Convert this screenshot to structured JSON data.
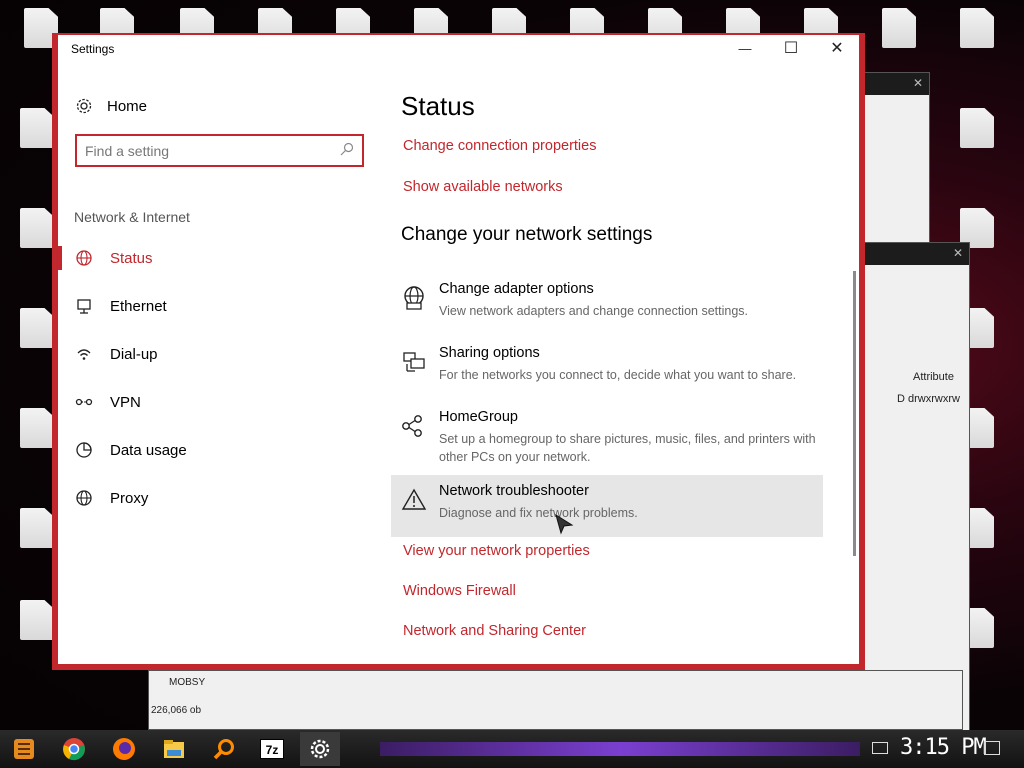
{
  "window": {
    "title": "Settings",
    "minimize_label": "—",
    "maximize_label": "☐",
    "close_label": "✕"
  },
  "sidebar": {
    "home_label": "Home",
    "search_placeholder": "Find a setting",
    "group_title": "Network & Internet",
    "items": [
      {
        "label": "Status",
        "icon": "status-globe-icon",
        "active": true
      },
      {
        "label": "Ethernet",
        "icon": "ethernet-icon"
      },
      {
        "label": "Dial-up",
        "icon": "dialup-icon"
      },
      {
        "label": "VPN",
        "icon": "vpn-icon"
      },
      {
        "label": "Data usage",
        "icon": "data-usage-icon"
      },
      {
        "label": "Proxy",
        "icon": "proxy-globe-icon"
      }
    ]
  },
  "main": {
    "title": "Status",
    "top_links": [
      "Change connection properties",
      "Show available networks"
    ],
    "section_title": "Change your network settings",
    "options": [
      {
        "title": "Change adapter options",
        "desc": "View network adapters and change connection settings.",
        "icon": "adapter-globe-icon"
      },
      {
        "title": "Sharing options",
        "desc": "For the networks you connect to, decide what you want to share.",
        "icon": "sharing-icon"
      },
      {
        "title": "HomeGroup",
        "desc": "Set up a homegroup to share pictures, music, files, and printers with other PCs on your network.",
        "icon": "homegroup-icon"
      },
      {
        "title": "Network troubleshooter",
        "desc": "Diagnose and fix network problems.",
        "icon": "warning-icon"
      }
    ],
    "bottom_links": [
      "View your network properties",
      "Windows Firewall",
      "Network and Sharing Center"
    ]
  },
  "background_window": {
    "column_header": "Attribute",
    "cell_value": "D drwxrwxrw",
    "status_text": "226,066 ob",
    "file_label": "MOBSY"
  },
  "taskbar": {
    "clock": "3:15 PM",
    "apps": [
      "start-icon",
      "chrome-icon",
      "firefox-icon",
      "file-explorer-icon",
      "search-icon",
      "7zip-icon",
      "settings-gear-icon"
    ],
    "sevenzip_label": "7z"
  },
  "colors": {
    "accent": "#c1272d",
    "hover_bg": "#e6e6e6"
  }
}
